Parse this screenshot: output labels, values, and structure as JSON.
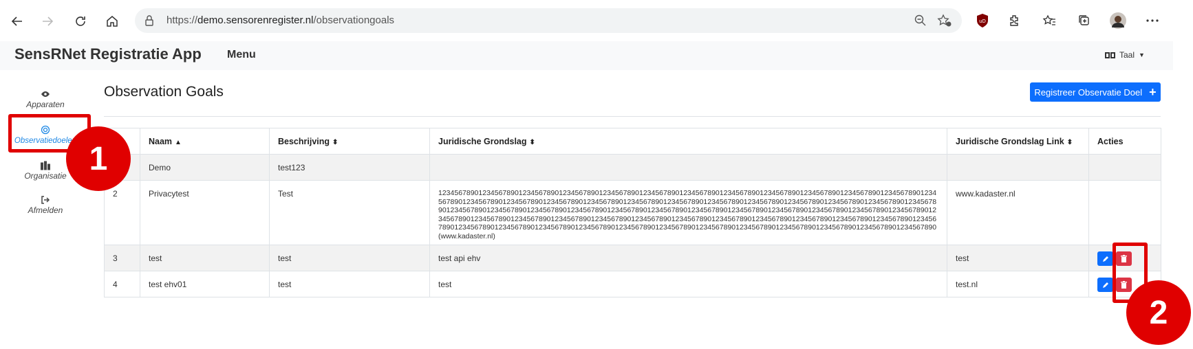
{
  "browser": {
    "url_prefix": "https://",
    "url_host": "demo.sensorenregister.nl",
    "url_path": "/observationgoals"
  },
  "navbar": {
    "brand": "SensRNet Registratie App",
    "menu": "Menu",
    "language": "Taal"
  },
  "sidebar": {
    "items": [
      {
        "label": "Apparaten"
      },
      {
        "label": "Observatiedoelen"
      },
      {
        "label": "Organisatie"
      },
      {
        "label": "Afmelden"
      }
    ]
  },
  "page": {
    "title": "Observation Goals",
    "add_button": "Registreer Observatie Doel"
  },
  "table": {
    "headers": [
      "Naam",
      "Beschrijving",
      "Juridische Grondslag",
      "Juridische Grondslag Link",
      "Acties"
    ],
    "rows": [
      {
        "id": "1",
        "naam": "Demo",
        "beschrijving": "test123",
        "grondslag": "",
        "link": ""
      },
      {
        "id": "2",
        "naam": "Privacytest",
        "beschrijving": "Test",
        "grondslag": "12345678901234567890123456789012345678901234567890123456789012345678901234567890123456789012345678901234567890123456789012345678901234567890123456789012345678901234567890123456789012345678901234567890123456789012345678901234567890123456789012345678901234567890123456789012345678901234567890123456789012345678901234567890123456789012345678901234567890123456789012345678901234567890123456789012345678901234567890123456789012345678901234567890123456789012345678901234567890123456789012345678901234567890123456789012345678901234567890123456789012345678901234567890123456789012345678901234567890123456789012345678901234567890 (www.kadaster.nl)",
        "link": "www.kadaster.nl"
      },
      {
        "id": "3",
        "naam": "test",
        "beschrijving": "test",
        "grondslag": "test api ehv",
        "link": "test"
      },
      {
        "id": "4",
        "naam": "test ehv01",
        "beschrijving": "test",
        "grondslag": "test",
        "link": "test.nl"
      }
    ]
  },
  "annotations": {
    "badge1": "1",
    "badge2": "2"
  },
  "colors": {
    "primary": "#0d6efd",
    "danger": "#dc3545",
    "annotation": "#e00000",
    "active_sidebar": "#1e88e5"
  }
}
